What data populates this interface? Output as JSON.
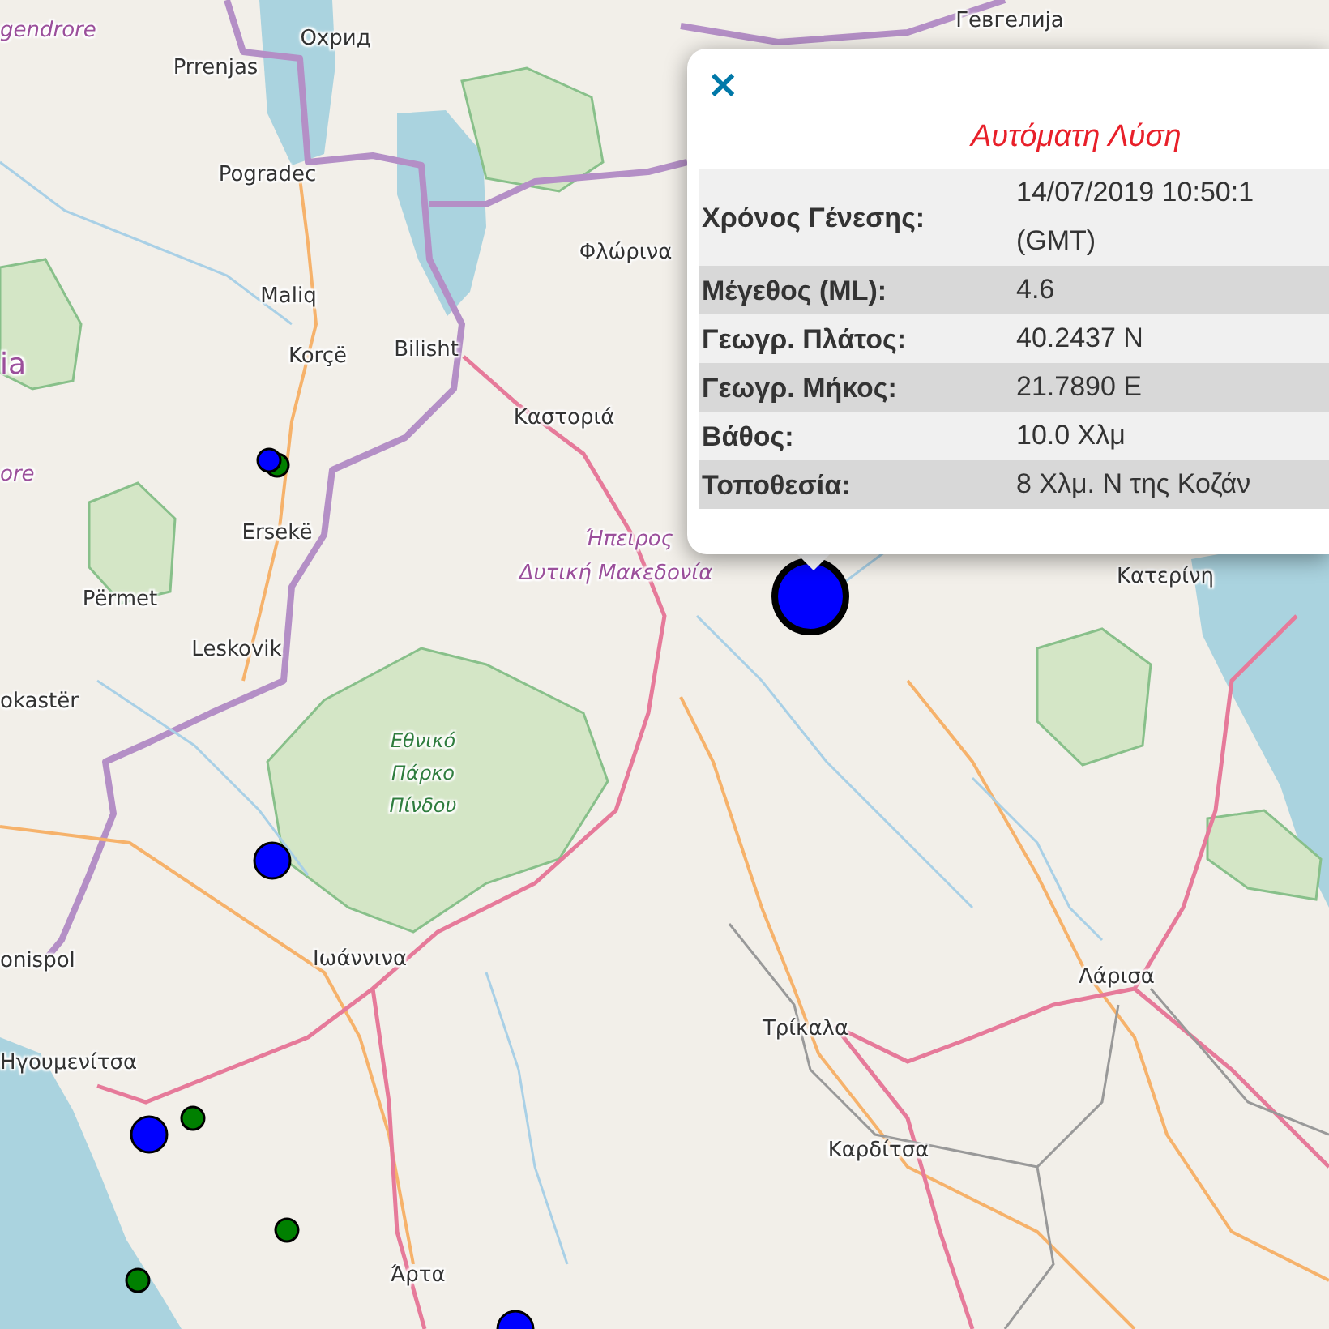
{
  "map": {
    "labels": [
      {
        "text": "gendrore",
        "kind": "region"
      },
      {
        "text": "Prrenjas",
        "kind": "city"
      },
      {
        "text": "Охрид",
        "kind": "city"
      },
      {
        "text": "Гевгелија",
        "kind": "city"
      },
      {
        "text": "Pogradec",
        "kind": "city"
      },
      {
        "text": "Φλώρινα",
        "kind": "city"
      },
      {
        "text": "Maliq",
        "kind": "city"
      },
      {
        "text": "Korçë",
        "kind": "city"
      },
      {
        "text": "Bilisht",
        "kind": "city"
      },
      {
        "text": "ia",
        "kind": "country"
      },
      {
        "text": "Καστοριά",
        "kind": "city"
      },
      {
        "text": "ore",
        "kind": "region"
      },
      {
        "text": "Ersekë",
        "kind": "city"
      },
      {
        "text": "Ήπειρος",
        "kind": "region"
      },
      {
        "text": "Δυτική Μακεδονία",
        "kind": "region"
      },
      {
        "text": "Κατερίνη",
        "kind": "city"
      },
      {
        "text": "Përmet",
        "kind": "city"
      },
      {
        "text": "Leskovik",
        "kind": "city"
      },
      {
        "text": "okastër",
        "kind": "city"
      },
      {
        "text": "Εθνικό Πάρκο Πίνδου",
        "kind": "park"
      },
      {
        "text": "onispol",
        "kind": "city"
      },
      {
        "text": "Ιωάννινα",
        "kind": "city"
      },
      {
        "text": "Λάρισα",
        "kind": "city"
      },
      {
        "text": "Τρίκαλα",
        "kind": "city"
      },
      {
        "text": "Ηγουμενίτσα",
        "kind": "city"
      },
      {
        "text": "Καρδίτσα",
        "kind": "city"
      },
      {
        "text": "Άρτα",
        "kind": "city"
      }
    ],
    "markers": [
      {
        "color": "#008000",
        "kind": "small",
        "selected": false
      },
      {
        "color": "#0000ff",
        "kind": "small",
        "selected": false
      },
      {
        "color": "#0000ff",
        "kind": "large",
        "selected": true
      },
      {
        "color": "#0000ff",
        "kind": "medium",
        "selected": false
      },
      {
        "color": "#0000ff",
        "kind": "medium",
        "selected": false
      },
      {
        "color": "#008000",
        "kind": "small",
        "selected": false
      },
      {
        "color": "#008000",
        "kind": "small",
        "selected": false
      },
      {
        "color": "#008000",
        "kind": "small",
        "selected": false
      },
      {
        "color": "#0000ff",
        "kind": "medium",
        "selected": false
      }
    ]
  },
  "popup": {
    "close": "×",
    "title": "Αυτόματη Λύση",
    "rows": [
      {
        "label": "Χρόνος Γένεσης:",
        "value": "14/07/2019 10:50:1 (GMT)"
      },
      {
        "label": "Μέγεθος (ML):",
        "value": "4.6"
      },
      {
        "label": "Γεωγρ. Πλάτος:",
        "value": "40.2437 N"
      },
      {
        "label": "Γεωγρ. Μήκος:",
        "value": "21.7890 E"
      },
      {
        "label": "Βάθος:",
        "value": "10.0 Χλμ"
      },
      {
        "label": "Τοποθεσία:",
        "value": "8 Χλμ. Ν της Κοζάν"
      }
    ]
  }
}
